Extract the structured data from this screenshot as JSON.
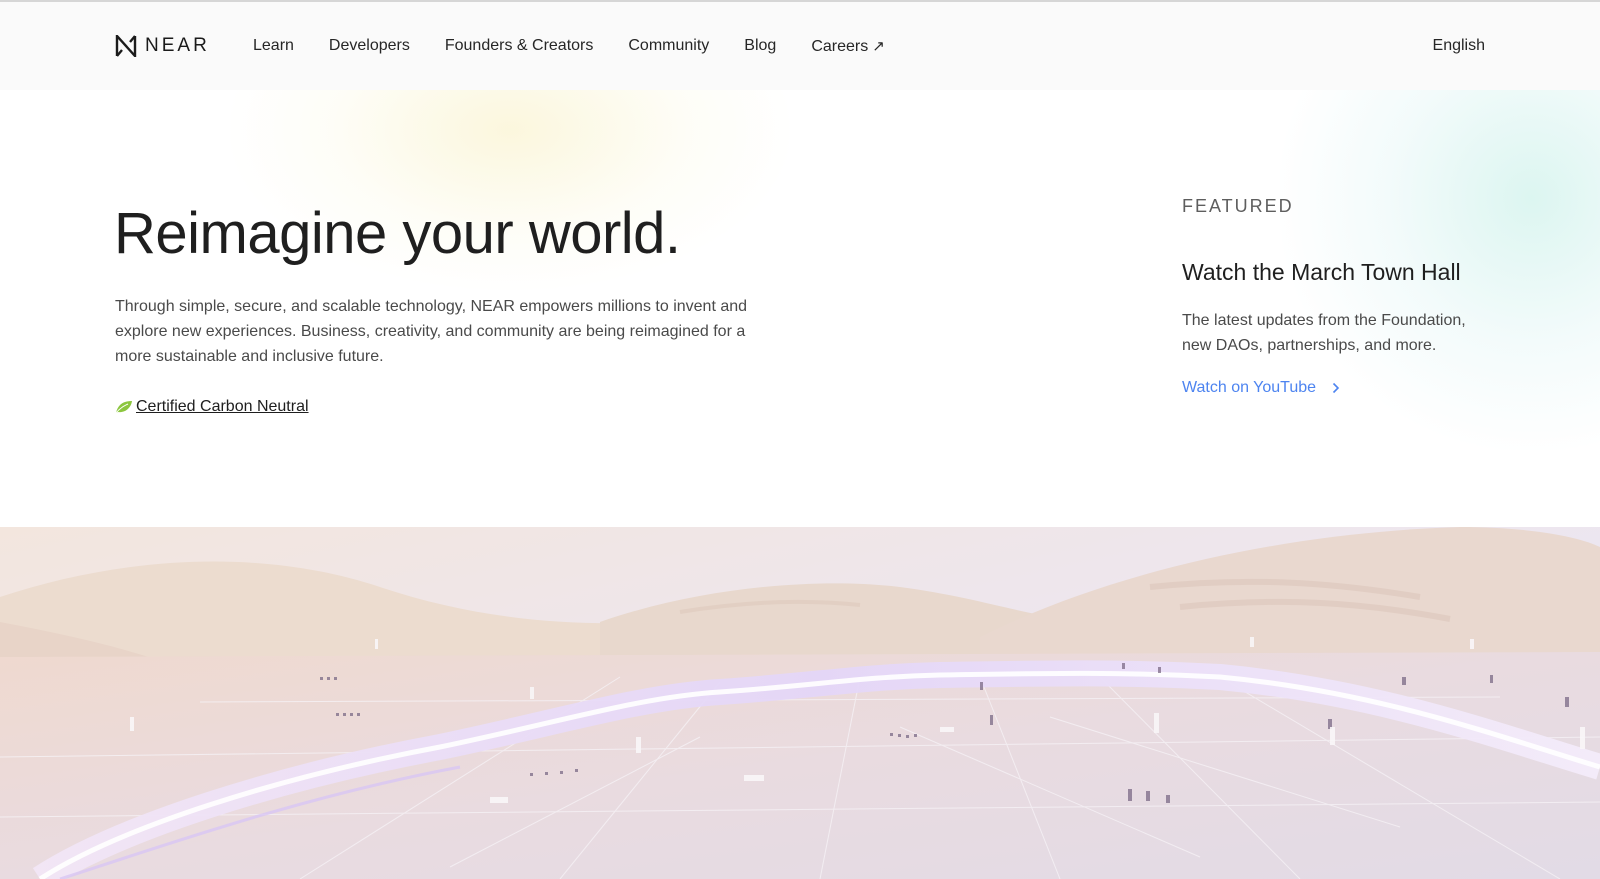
{
  "nav": {
    "brand": "NEAR",
    "links": [
      {
        "label": "Learn"
      },
      {
        "label": "Developers"
      },
      {
        "label": "Founders & Creators"
      },
      {
        "label": "Community"
      },
      {
        "label": "Blog"
      },
      {
        "label": "Careers",
        "icon": "external-arrow-icon",
        "glyph": "↗"
      }
    ],
    "language": "English"
  },
  "hero": {
    "title": "Reimagine your world.",
    "description": "Through simple, secure, and scalable technology, NEAR empowers millions to invent and explore new experiences. Business, creativity, and community are being reimagined for a more sustainable and inclusive future.",
    "carbon_link": "Certified Carbon Neutral",
    "carbon_icon": "leaf-icon"
  },
  "featured": {
    "label": "FEATURED",
    "title": "Watch the March Town Hall",
    "description": "The latest updates from the Foundation, new DAOs, partnerships, and more.",
    "link_label": "Watch on YouTube",
    "link_icon": "chevron-right-icon",
    "link_color": "#4d84f0"
  },
  "theme": {
    "nav_background": "#fafafa",
    "leaf_color": "#8cc63f"
  }
}
